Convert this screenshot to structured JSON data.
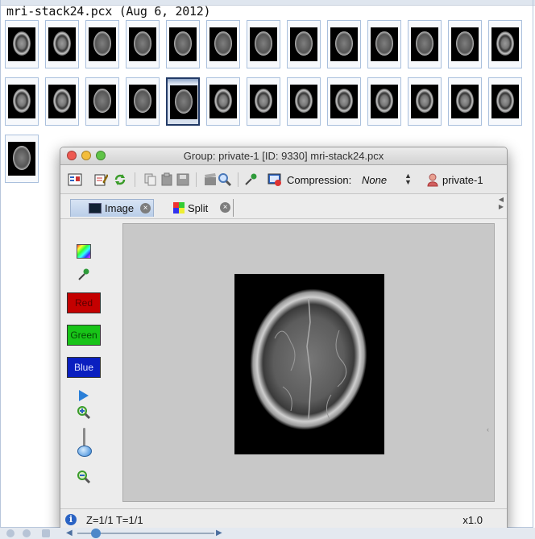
{
  "browser": {
    "stack_title": "mri-stack24.pcx (Aug 6, 2012)",
    "thumbnail_count": 27,
    "selected_index": 17
  },
  "window": {
    "title": "Group: private-1 [ID: 9330] mri-stack24.pcx",
    "toolbar": {
      "compression_label": "Compression:",
      "compression_value": "None",
      "user_label": "private-1"
    },
    "tabs": [
      {
        "label": "Image"
      },
      {
        "label": "Split"
      }
    ],
    "channels": {
      "red": "Red",
      "green": "Green",
      "blue": "Blue"
    },
    "status": {
      "zt": "Z=1/1 T=1/1",
      "zoom": "x1.0"
    }
  },
  "colors": {
    "accent": "#2a63c4",
    "red_channel": "#c40000",
    "green_channel": "#18c418",
    "blue_channel": "#0a1fc0"
  }
}
